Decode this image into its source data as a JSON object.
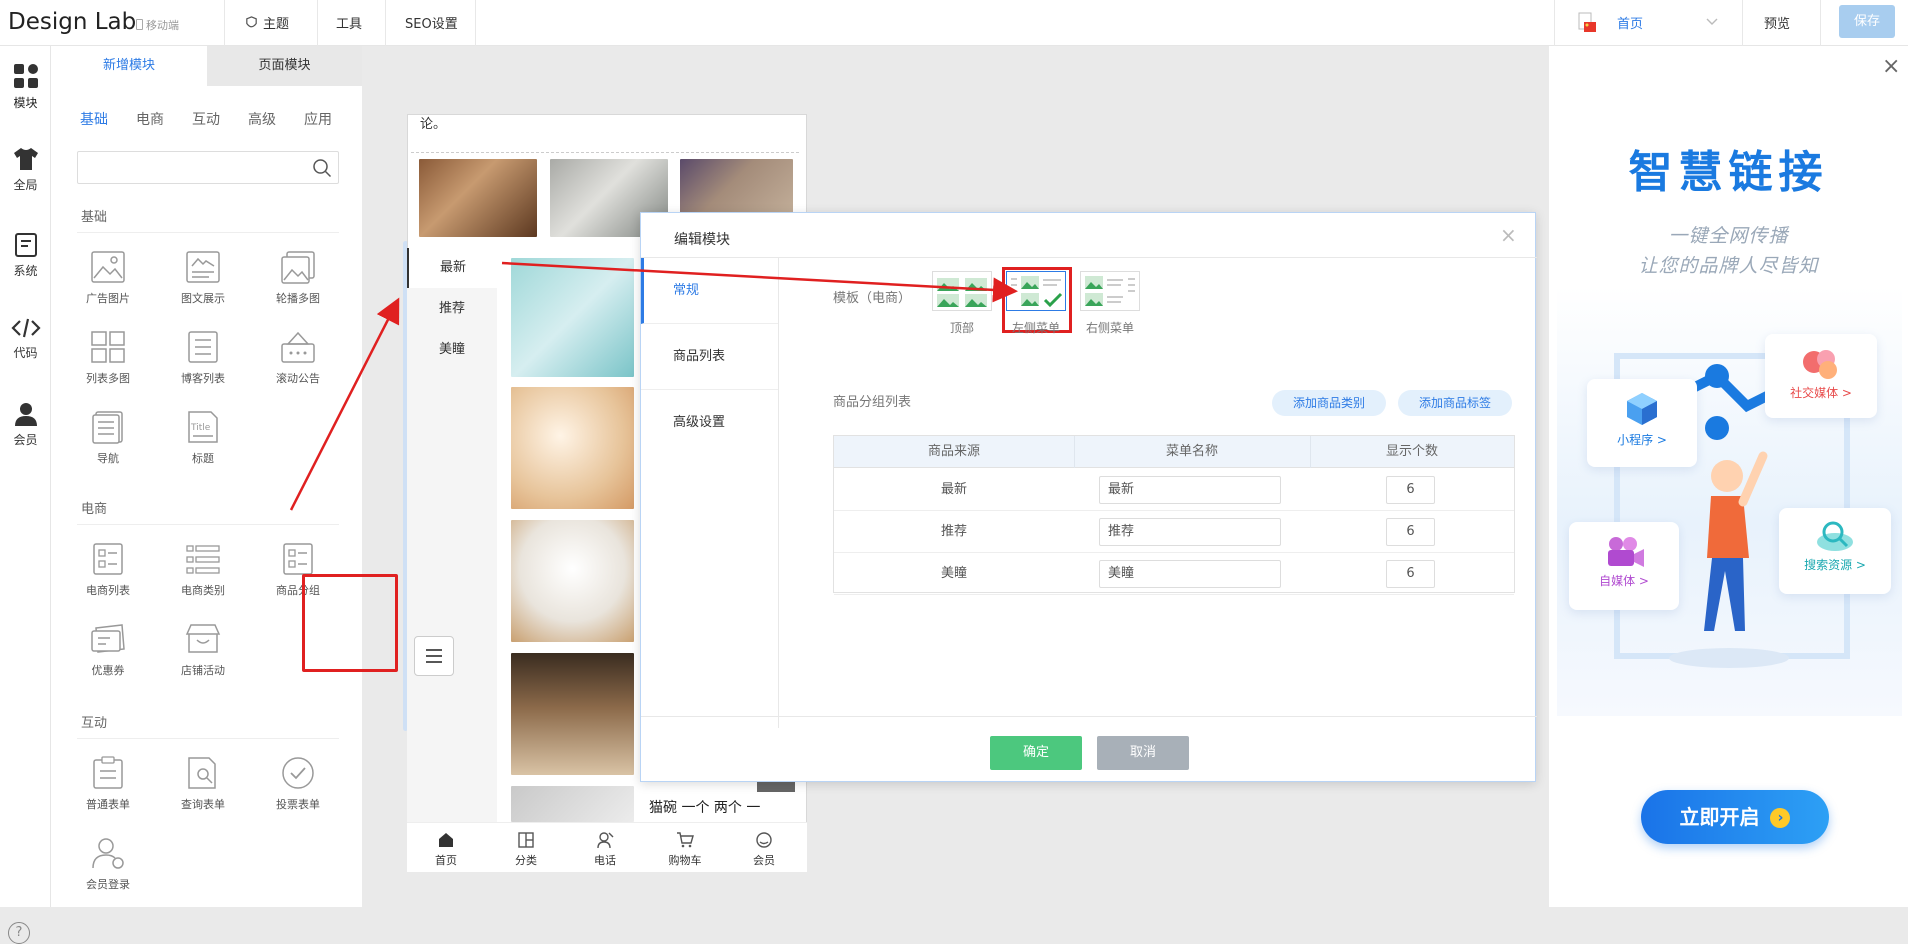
{
  "app": {
    "logo": "Design Lab",
    "mobile_label": "移动端"
  },
  "topnav": {
    "theme": "主题",
    "tools": "工具",
    "seo": "SEO设置",
    "page_select": "首页",
    "preview": "预览",
    "save": "保存"
  },
  "rail": [
    {
      "label": "模块",
      "icon": "grid-icon"
    },
    {
      "label": "全局",
      "icon": "shirt-icon"
    },
    {
      "label": "系统",
      "icon": "document-icon"
    },
    {
      "label": "代码",
      "icon": "code-icon"
    },
    {
      "label": "会员",
      "icon": "user-icon"
    }
  ],
  "panel": {
    "tabs": {
      "add": "新增模块",
      "page": "页面模块"
    },
    "subcats": [
      "基础",
      "电商",
      "互动",
      "高级",
      "应用"
    ],
    "sections": {
      "basic": "基础",
      "ecommerce": "电商",
      "interactive": "互动"
    },
    "basic_modules": [
      "广告图片",
      "图文展示",
      "轮播多图",
      "列表多图",
      "博客列表",
      "滚动公告",
      "导航",
      "标题"
    ],
    "ecommerce_modules": [
      "电商列表",
      "电商类别",
      "商品分组",
      "优惠券",
      "店铺活动"
    ],
    "interactive_modules": [
      "普通表单",
      "查询表单",
      "投票表单",
      "会员登录"
    ]
  },
  "phone": {
    "top_text": "论。",
    "menu": [
      "最新",
      "推荐",
      "美瞳"
    ],
    "product_caption": "猫碗 一个 两个 一",
    "bottom_nav": [
      "首页",
      "分类",
      "电话",
      "购物车",
      "会员"
    ]
  },
  "dialog": {
    "title": "编辑模块",
    "close": "×",
    "side_tabs": [
      "常规",
      "商品列表",
      "高级设置"
    ],
    "template_label": "模板（电商）",
    "templates": [
      "顶部",
      "左侧菜单",
      "右侧菜单"
    ],
    "selected_template": "左侧菜单",
    "group_label": "商品分组列表",
    "add_category": "添加商品类别",
    "add_tag": "添加商品标签",
    "table_headers": [
      "商品来源",
      "菜单名称",
      "显示个数"
    ],
    "rows": [
      {
        "source": "最新",
        "name": "最新",
        "count": "6"
      },
      {
        "source": "推荐",
        "name": "推荐",
        "count": "6"
      },
      {
        "source": "美瞳",
        "name": "美瞳",
        "count": "6"
      }
    ],
    "confirm": "确定",
    "cancel": "取消"
  },
  "ad": {
    "close": "×",
    "title": "智慧链接",
    "line1": "一键全网传播",
    "line2": "让您的品牌人尽皆知",
    "cards": [
      "小程序 >",
      "社交媒体 >",
      "自媒体 >",
      "搜索资源 >"
    ],
    "cta": "立即开启"
  },
  "help": "?",
  "colors": {
    "accent": "#2d7be5",
    "highlight": "#e02020",
    "confirm": "#4cc87e",
    "cancel": "#a8b0b8",
    "ad_blue": "#1a7ae0"
  }
}
